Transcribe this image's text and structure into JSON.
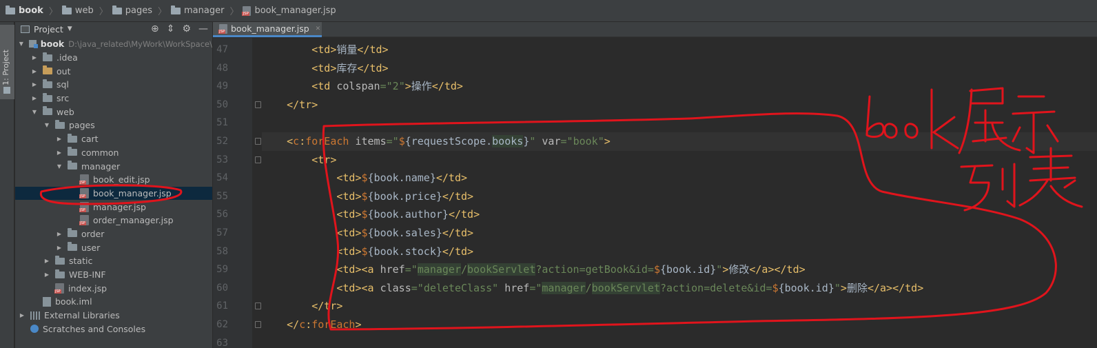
{
  "breadcrumb": {
    "items": [
      "book",
      "web",
      "pages",
      "manager",
      "book_manager.jsp"
    ]
  },
  "tool_stripe": {
    "label": "1: Project"
  },
  "project_panel": {
    "title": "Project",
    "tree": [
      {
        "label": "book",
        "path": "D:\\java_related\\MyWork\\WorkSpace\\",
        "depth": 0,
        "kind": "module",
        "expanded": true
      },
      {
        "label": ".idea",
        "depth": 1,
        "kind": "folder",
        "expanded": false
      },
      {
        "label": "out",
        "depth": 1,
        "kind": "folder-excluded",
        "expanded": false
      },
      {
        "label": "sql",
        "depth": 1,
        "kind": "folder",
        "expanded": false
      },
      {
        "label": "src",
        "depth": 1,
        "kind": "folder",
        "expanded": false
      },
      {
        "label": "web",
        "depth": 1,
        "kind": "folder",
        "expanded": true
      },
      {
        "label": "pages",
        "depth": 2,
        "kind": "folder",
        "expanded": true
      },
      {
        "label": "cart",
        "depth": 3,
        "kind": "folder",
        "expanded": false
      },
      {
        "label": "common",
        "depth": 3,
        "kind": "folder",
        "expanded": false
      },
      {
        "label": "manager",
        "depth": 3,
        "kind": "folder",
        "expanded": true
      },
      {
        "label": "book_edit.jsp",
        "depth": 4,
        "kind": "jsp"
      },
      {
        "label": "book_manager.jsp",
        "depth": 4,
        "kind": "jsp",
        "selected": true
      },
      {
        "label": "manager.jsp",
        "depth": 4,
        "kind": "jsp"
      },
      {
        "label": "order_manager.jsp",
        "depth": 4,
        "kind": "jsp"
      },
      {
        "label": "order",
        "depth": 3,
        "kind": "folder",
        "expanded": false
      },
      {
        "label": "user",
        "depth": 3,
        "kind": "folder",
        "expanded": false
      },
      {
        "label": "static",
        "depth": 2,
        "kind": "folder",
        "expanded": false
      },
      {
        "label": "WEB-INF",
        "depth": 2,
        "kind": "folder",
        "expanded": false
      },
      {
        "label": "index.jsp",
        "depth": 2,
        "kind": "jsp"
      },
      {
        "label": "book.iml",
        "depth": 1,
        "kind": "iml"
      },
      {
        "label": "External Libraries",
        "depth": 0,
        "kind": "libs",
        "expanded": false
      },
      {
        "label": "Scratches and Consoles",
        "depth": 0,
        "kind": "scratch"
      }
    ]
  },
  "editor": {
    "active_tab": "book_manager.jsp",
    "current_line": 52,
    "lines": [
      {
        "n": 47,
        "text": "        <td>销量</td>"
      },
      {
        "n": 48,
        "text": "        <td>库存</td>"
      },
      {
        "n": 49,
        "text": "        <td colspan=\"2\">操作</td>"
      },
      {
        "n": 50,
        "text": "    </tr>"
      },
      {
        "n": 51,
        "text": ""
      },
      {
        "n": 52,
        "text": "    <c:forEach items=\"${requestScope.books}\" var=\"book\">"
      },
      {
        "n": 53,
        "text": "        <tr>"
      },
      {
        "n": 54,
        "text": "            <td>${book.name}</td>"
      },
      {
        "n": 55,
        "text": "            <td>${book.price}</td>"
      },
      {
        "n": 56,
        "text": "            <td>${book.author}</td>"
      },
      {
        "n": 57,
        "text": "            <td>${book.sales}</td>"
      },
      {
        "n": 58,
        "text": "            <td>${book.stock}</td>"
      },
      {
        "n": 59,
        "text": "            <td><a href=\"manager/bookServlet?action=getBook&id=${book.id}\">修改</a></td>"
      },
      {
        "n": 60,
        "text": "            <td><a class=\"deleteClass\" href=\"manager/bookServlet?action=delete&id=${book.id}\">删除</a></td>"
      },
      {
        "n": 61,
        "text": "        </tr>"
      },
      {
        "n": 62,
        "text": "    </c:forEach>"
      },
      {
        "n": 63,
        "text": ""
      }
    ]
  },
  "annotation": {
    "handwritten_text": "book展示列表",
    "color": "#e0141c"
  },
  "colors": {
    "tag": "#e8bf6a",
    "attr": "#bababa",
    "string": "#6a8759",
    "keyword": "#cc7832",
    "text": "#a9b7c6",
    "selection": "#0d293e",
    "accent": "#4a88c7"
  }
}
